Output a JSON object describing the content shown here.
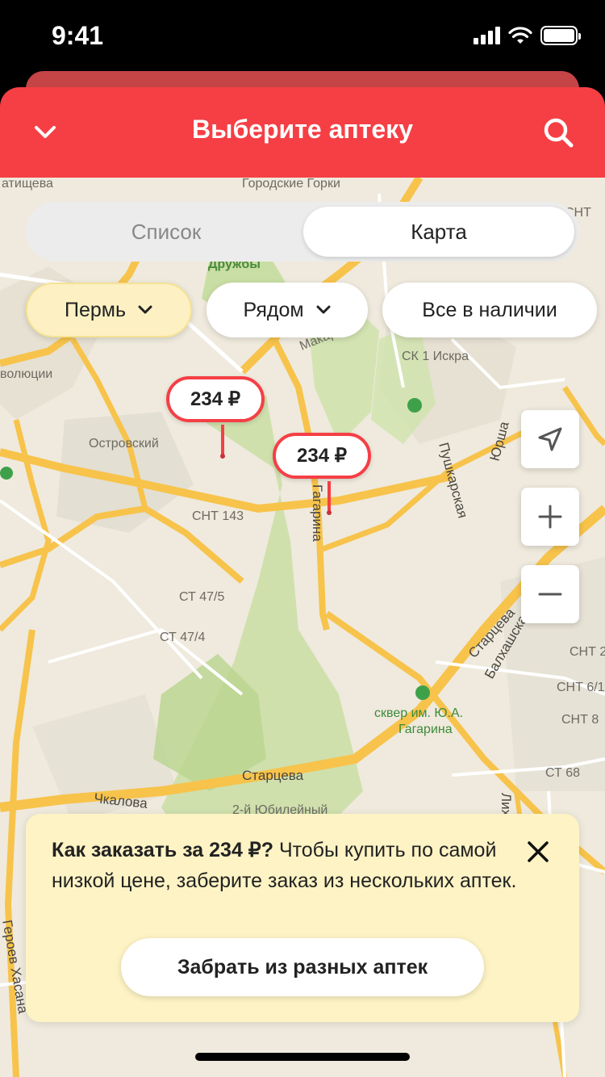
{
  "status_bar": {
    "time": "9:41"
  },
  "header": {
    "title": "Выберите аптеку",
    "back_icon": "chevron-down-icon",
    "search_icon": "search-icon"
  },
  "view_toggle": {
    "tabs": [
      "Список",
      "Карта"
    ],
    "selected": "Карта"
  },
  "filters": {
    "city": "Пермь",
    "distance": "Рядом",
    "stock": "Все в наличии"
  },
  "map": {
    "labels": [
      "атищева",
      "Городские Горки",
      "Дружбы",
      "волюции",
      "Островский",
      "СНТ 143",
      "СТ 47/5",
      "СТ 47/4",
      "Гагарина",
      "Пушкарская",
      "Юрша",
      "СК 1 Искра",
      "Старцева",
      "Балхашская",
      "сквер им. Ю.А.",
      "Гагарина",
      "Старцева",
      "Чкалова",
      "2-й Юбилейный",
      "СНТ",
      "СНТ 2",
      "СНТ 6/1",
      "СНТ 8",
      "СТ 68",
      "Макар",
      "Героев Хасана",
      "Лих"
    ],
    "pins": [
      {
        "price": "234 ₽"
      },
      {
        "price": "234 ₽"
      }
    ],
    "controls": [
      "location-arrow-icon",
      "zoom-in-icon",
      "zoom-out-icon"
    ]
  },
  "info_card": {
    "headline": "Как заказать за 234 ₽?",
    "body": " Чтобы купить по самой низкой цене, заберите заказ из нескольких аптек.",
    "button": "Забрать из разных аптек"
  },
  "colors": {
    "brand_red": "#f53f45",
    "chip_yellow": "#fdf1c3",
    "card_yellow": "#fdf3c4",
    "road": "#f7c34b",
    "park": "#c9dea4"
  }
}
